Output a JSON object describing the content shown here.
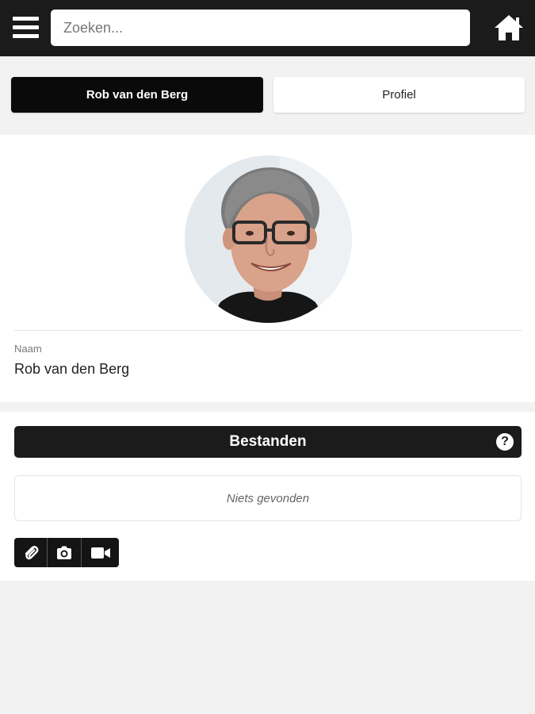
{
  "header": {
    "menu_icon": "hamburger-menu-icon",
    "search_placeholder": "Zoeken...",
    "search_value": "",
    "home_icon": "home-icon"
  },
  "tabs": [
    {
      "label": "Rob van den Berg",
      "active": true
    },
    {
      "label": "Profiel",
      "active": false
    }
  ],
  "profile": {
    "avatar_icon": "profile-photo",
    "name_label": "Naam",
    "name_value": "Rob van den Berg"
  },
  "files": {
    "title": "Bestanden",
    "help_icon": "question-circle-icon",
    "help_glyph": "?",
    "empty_text": "Niets gevonden",
    "actions": [
      {
        "icon": "paperclip-icon"
      },
      {
        "icon": "camera-icon"
      },
      {
        "icon": "video-camera-icon"
      }
    ]
  },
  "colors": {
    "header_bg": "#1b1b1b",
    "page_bg": "#f2f2f2",
    "active_tab_bg": "#0a0a0a",
    "card_bg": "#ffffff"
  }
}
